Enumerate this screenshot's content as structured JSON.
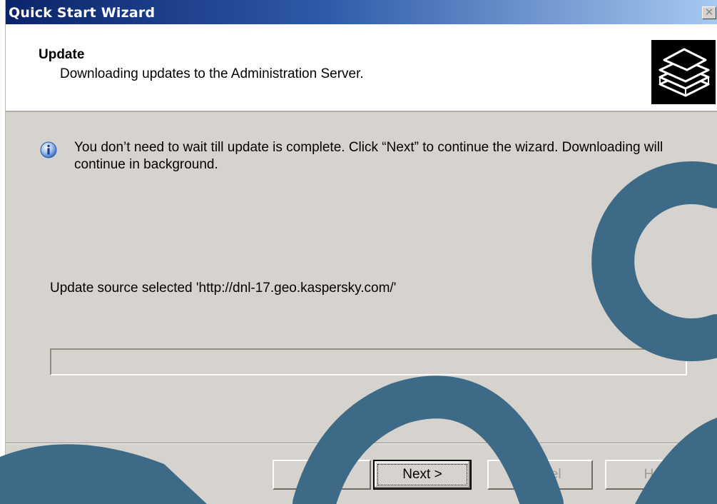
{
  "window": {
    "title": "Quick Start Wizard",
    "close_glyph": "✕"
  },
  "header": {
    "title": "Update",
    "subtitle": "Downloading updates to the Administration Server.",
    "icon": "book-stack-icon"
  },
  "content": {
    "info_icon": "info-icon",
    "info_text": "You don’t need to wait till update is complete. Click “Next” to continue the wizard. Downloading will continue in background.",
    "status_text": "Update source selected 'http://dnl-17.geo.kaspersky.com/'",
    "progress_fraction": 0
  },
  "buttons": {
    "back": {
      "label": "< Back",
      "enabled": false
    },
    "next": {
      "label": "Next >",
      "enabled": true
    },
    "cancel": {
      "label": "Cancel",
      "enabled": false
    },
    "help": {
      "label": "Help",
      "enabled": false
    }
  },
  "colors": {
    "titlebar_start": "#0a246a",
    "titlebar_end": "#a6caf0",
    "dialog_face": "#d6d3ce",
    "watermark": "#3d6b87"
  }
}
